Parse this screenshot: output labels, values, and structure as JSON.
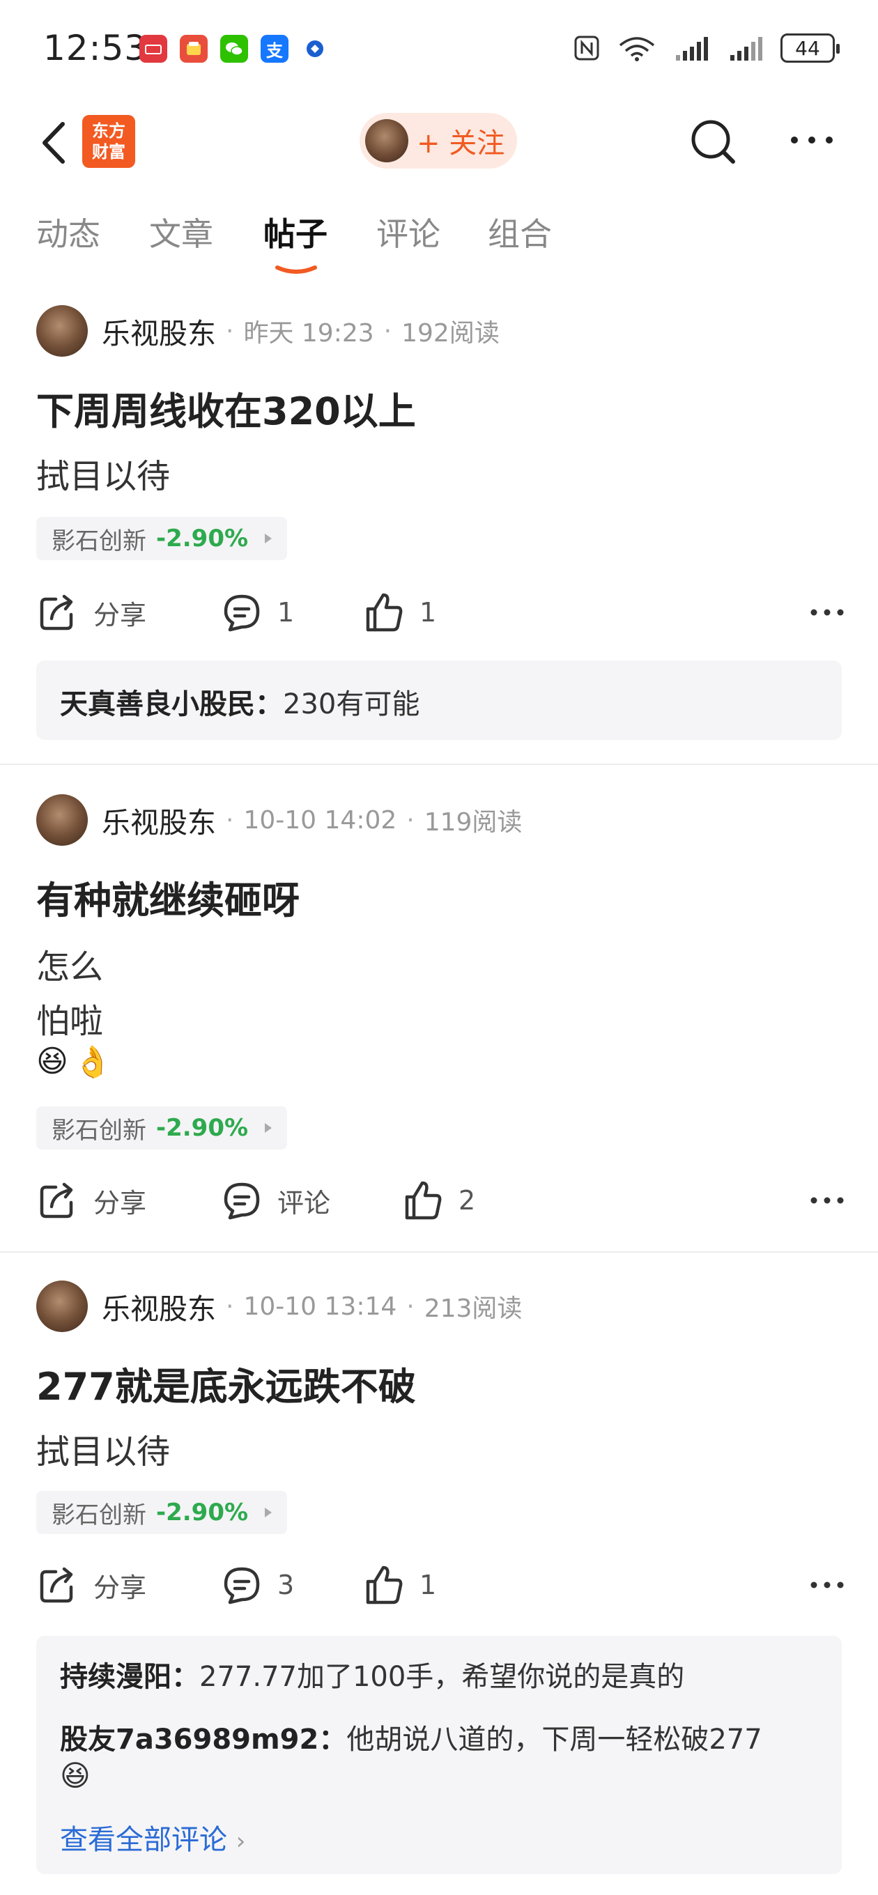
{
  "status_bar": {
    "time": "12:53",
    "battery": "44",
    "app_icons": [
      "huawei-app-icon",
      "taobao-app-icon",
      "wechat-icon",
      "alipay-icon",
      "browser-icon"
    ],
    "sys_icons": [
      "nfc-icon",
      "wifi-icon",
      "signal-icon",
      "signal-icon",
      "battery-icon"
    ]
  },
  "header": {
    "logo_line1": "东方",
    "logo_line2": "财富",
    "follow_label": "+ 关注"
  },
  "tabs": [
    "动态",
    "文章",
    "帖子",
    "评论",
    "组合"
  ],
  "active_tab": "帖子",
  "posts": [
    {
      "author": "乐视股东",
      "time": "昨天 19:23",
      "reads": "192阅读",
      "title": "下周周线收在320以上",
      "body": [
        "拭目以待"
      ],
      "stock_name": "影石创新",
      "stock_change": "-2.90%",
      "share_label": "分享",
      "comment_label": "1",
      "like_count": "1",
      "comments": [
        {
          "user": "天真善良小股民：",
          "text": "230有可能"
        }
      ]
    },
    {
      "author": "乐视股东",
      "time": "10-10 14:02",
      "reads": "119阅读",
      "title": "有种就继续砸呀",
      "body": [
        "怎么",
        "怕啦"
      ],
      "emojis": [
        "😆",
        "👌"
      ],
      "stock_name": "影石创新",
      "stock_change": "-2.90%",
      "share_label": "分享",
      "comment_label": "评论",
      "like_count": "2"
    },
    {
      "author": "乐视股东",
      "time": "10-10 13:14",
      "reads": "213阅读",
      "title": "277就是底永远跌不破",
      "body": [
        "拭目以待"
      ],
      "stock_name": "影石创新",
      "stock_change": "-2.90%",
      "share_label": "分享",
      "comment_label": "3",
      "like_count": "1",
      "comments": [
        {
          "user": "持续漫阳：",
          "text": "277.77加了100手，希望你说的是真的"
        },
        {
          "user": "股友7a36989m92：",
          "text": "他胡说八道的，下周一轻松破277",
          "emoji": "😆"
        }
      ],
      "view_all": "查看全部评论"
    }
  ],
  "colors": {
    "accent": "#f15a22",
    "stock_down": "#2eaa4e",
    "link": "#2a6bd6"
  }
}
